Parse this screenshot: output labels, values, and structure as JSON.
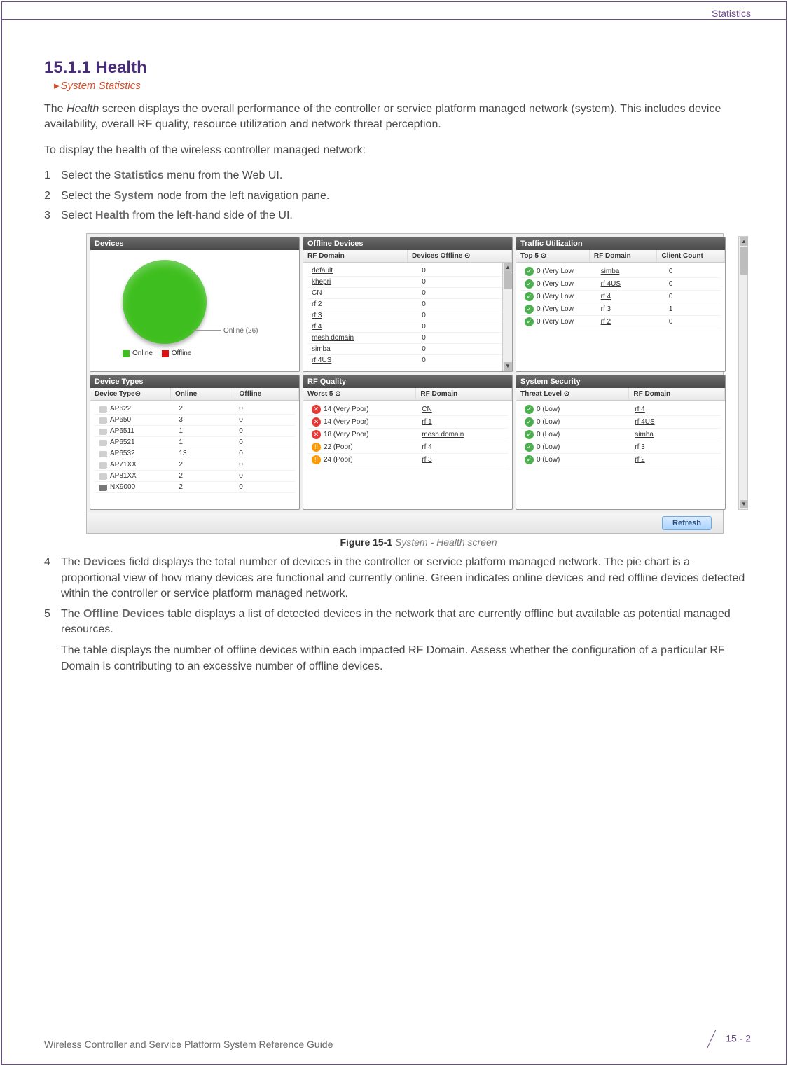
{
  "header": {
    "section": "Statistics"
  },
  "title": "15.1.1 Health",
  "breadcrumb": "System Statistics",
  "intro": "The Health screen displays the overall performance of the controller or service platform managed network (system). This includes device availability, overall RF quality, resource utilization and network threat perception.",
  "lead": "To display the health of the wireless controller managed network:",
  "steps": {
    "s1a": "Select the ",
    "s1b": "Statistics",
    "s1c": " menu from the Web UI.",
    "s2a": "Select the ",
    "s2b": "System",
    "s2c": " node from the left navigation pane.",
    "s3a": "Select ",
    "s3b": "Health",
    "s3c": " from the left-hand side of the UI."
  },
  "ui": {
    "devices": {
      "title": "Devices",
      "pie_label": "Online (26)",
      "legend_online": "Online",
      "legend_offline": "Offline"
    },
    "offline": {
      "title": "Offline Devices",
      "col_domain": "RF Domain",
      "col_offline": "Devices Offline",
      "rows": [
        {
          "d": "default",
          "v": "0"
        },
        {
          "d": "khepri",
          "v": "0"
        },
        {
          "d": "CN",
          "v": "0"
        },
        {
          "d": "rf 2",
          "v": "0"
        },
        {
          "d": "rf 3",
          "v": "0"
        },
        {
          "d": "rf 4",
          "v": "0"
        },
        {
          "d": "mesh domain",
          "v": "0"
        },
        {
          "d": "simba",
          "v": "0"
        },
        {
          "d": "rf 4US",
          "v": "0"
        }
      ]
    },
    "traffic": {
      "title": "Traffic Utilization",
      "col_top5": "Top 5",
      "col_domain": "RF Domain",
      "col_count": "Client Count",
      "rows": [
        {
          "v": "0 (Very Low",
          "d": "simba",
          "c": "0"
        },
        {
          "v": "0 (Very Low",
          "d": "rf 4US",
          "c": "0"
        },
        {
          "v": "0 (Very Low",
          "d": "rf 4",
          "c": "0"
        },
        {
          "v": "0 (Very Low",
          "d": "rf 3",
          "c": "1"
        },
        {
          "v": "0 (Very Low",
          "d": "rf 2",
          "c": "0"
        }
      ]
    },
    "types": {
      "title": "Device Types",
      "col_type": "Device Type",
      "col_online": "Online",
      "col_offline": "Offline",
      "rows": [
        {
          "t": "AP622",
          "on": "2",
          "off": "0"
        },
        {
          "t": "AP650",
          "on": "3",
          "off": "0"
        },
        {
          "t": "AP6511",
          "on": "1",
          "off": "0"
        },
        {
          "t": "AP6521",
          "on": "1",
          "off": "0"
        },
        {
          "t": "AP6532",
          "on": "13",
          "off": "0"
        },
        {
          "t": "AP71XX",
          "on": "2",
          "off": "0"
        },
        {
          "t": "AP81XX",
          "on": "2",
          "off": "0"
        },
        {
          "t": "NX9000",
          "on": "2",
          "off": "0",
          "ctrl": true
        }
      ]
    },
    "rfq": {
      "title": "RF Quality",
      "col_worst": "Worst 5",
      "col_domain": "RF Domain",
      "rows": [
        {
          "s": "bad",
          "v": "14 (Very Poor)",
          "d": "CN"
        },
        {
          "s": "bad",
          "v": "14 (Very Poor)",
          "d": "rf 1"
        },
        {
          "s": "bad",
          "v": "18 (Very Poor)",
          "d": "mesh domain"
        },
        {
          "s": "warn",
          "v": "22 (Poor)",
          "d": "rf 4"
        },
        {
          "s": "warn",
          "v": "24 (Poor)",
          "d": "rf 3"
        }
      ]
    },
    "sec": {
      "title": "System Security",
      "col_threat": "Threat Level",
      "col_domain": "RF Domain",
      "rows": [
        {
          "v": "0 (Low)",
          "d": "rf 4"
        },
        {
          "v": "0 (Low)",
          "d": "rf 4US"
        },
        {
          "v": "0 (Low)",
          "d": "simba"
        },
        {
          "v": "0 (Low)",
          "d": "rf 3"
        },
        {
          "v": "0 (Low)",
          "d": "rf 2"
        }
      ]
    },
    "refresh": "Refresh"
  },
  "caption_b": "Figure 15-1",
  "caption_i": "  System - Health screen",
  "step4": {
    "a": "The ",
    "b": "Devices",
    "c": " field displays the total number of devices in the controller or service platform managed network. The pie chart is a proportional view of how many devices are functional and currently online. Green indicates online devices and red offline devices detected within the controller or service platform managed network."
  },
  "step5": {
    "a": "The ",
    "b": "Offline Devices",
    "c": " table displays a list of detected devices in the network that are currently offline but available as potential managed resources.",
    "d": "The table displays the number of offline devices within each impacted RF Domain. Assess whether the configuration of a particular RF Domain is contributing to an excessive number of offline devices."
  },
  "footer": {
    "guide": "Wireless Controller and Service Platform System Reference Guide",
    "page": "15 - 2"
  }
}
